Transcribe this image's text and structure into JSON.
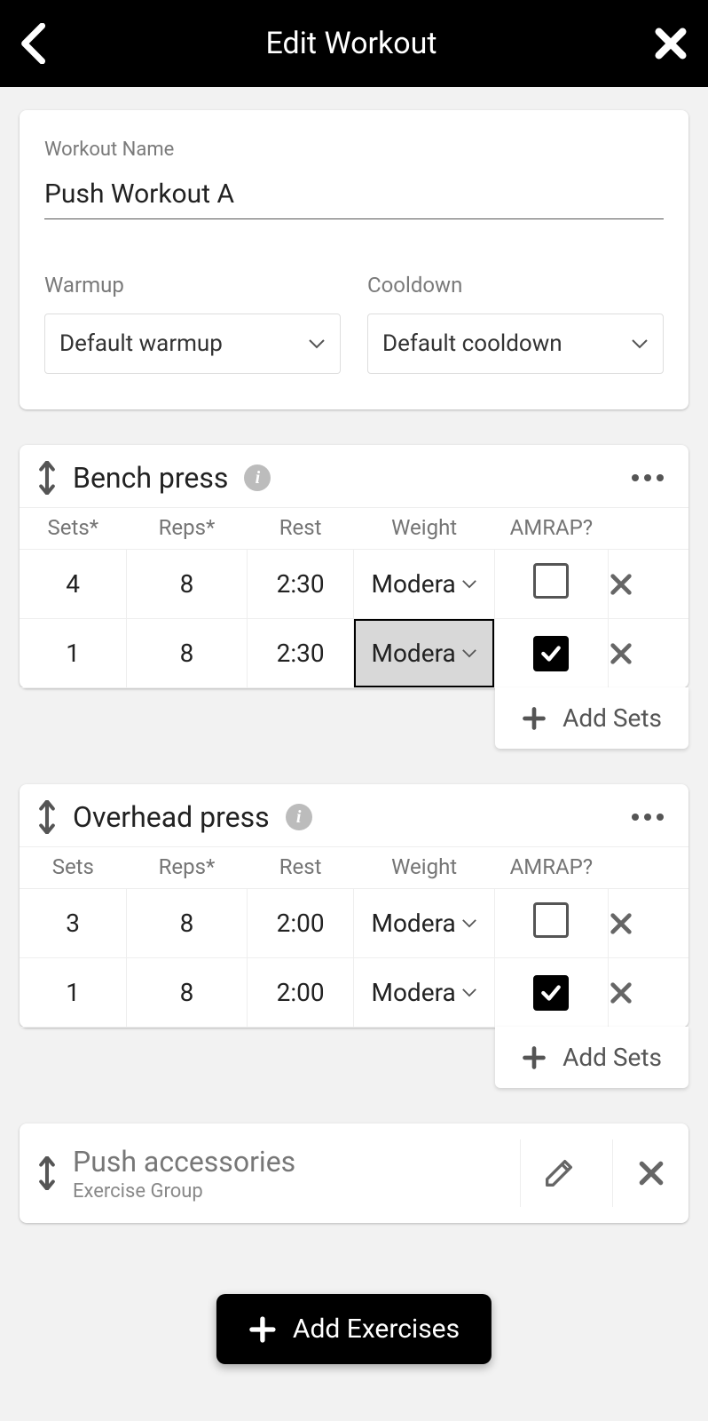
{
  "header": {
    "title": "Edit Workout"
  },
  "workout": {
    "name_label": "Workout Name",
    "name_value": "Push Workout A",
    "warmup_label": "Warmup",
    "warmup_value": "Default warmup",
    "cooldown_label": "Cooldown",
    "cooldown_value": "Default cooldown"
  },
  "columns": {
    "sets_req": "Sets*",
    "sets": "Sets",
    "reps_req": "Reps*",
    "rest": "Rest",
    "weight": "Weight",
    "amrap": "AMRAP?"
  },
  "exercises": [
    {
      "name": "Bench press",
      "sets_header": "Sets*",
      "rows": [
        {
          "sets": "4",
          "reps": "8",
          "rest": "2:30",
          "weight": "Modera",
          "amrap": false,
          "focused": false
        },
        {
          "sets": "1",
          "reps": "8",
          "rest": "2:30",
          "weight": "Modera",
          "amrap": true,
          "focused": true
        }
      ]
    },
    {
      "name": "Overhead press",
      "sets_header": "Sets",
      "rows": [
        {
          "sets": "3",
          "reps": "8",
          "rest": "2:00",
          "weight": "Modera",
          "amrap": false,
          "focused": false
        },
        {
          "sets": "1",
          "reps": "8",
          "rest": "2:00",
          "weight": "Modera",
          "amrap": true,
          "focused": false
        }
      ]
    }
  ],
  "group": {
    "title": "Push accessories",
    "subtitle": "Exercise Group"
  },
  "buttons": {
    "add_sets": "Add Sets",
    "add_exercises": "Add Exercises"
  }
}
